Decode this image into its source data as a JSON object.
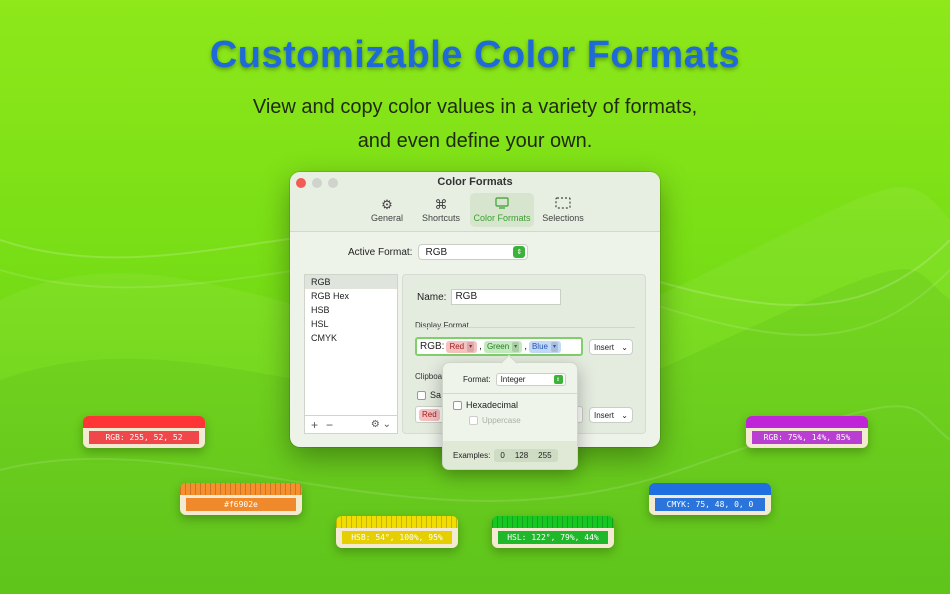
{
  "headline": "Customizable Color Formats",
  "subtitle": {
    "line1": "View and copy color values in a variety of formats,",
    "line2": "and even define your own."
  },
  "window": {
    "title": "Color Formats",
    "toolbar": [
      {
        "label": "General",
        "icon": "gear-icon"
      },
      {
        "label": "Shortcuts",
        "icon": "command-icon"
      },
      {
        "label": "Color Formats",
        "icon": "display-icon",
        "active": true
      },
      {
        "label": "Selections",
        "icon": "selection-icon"
      }
    ],
    "active_format_label": "Active Format:",
    "active_format_value": "RGB",
    "formats": [
      "RGB",
      "RGB Hex",
      "HSB",
      "HSL",
      "CMYK"
    ],
    "selected_format": "RGB",
    "list_footer": {
      "add": "+",
      "remove": "−",
      "gear": "⚙ ⌄"
    },
    "name_label": "Name:",
    "name_value": "RGB",
    "display_format_label": "Display Format",
    "display_prefix": "RGB:",
    "tokens": [
      "Red",
      "Green",
      "Blue"
    ],
    "separator": ",",
    "insert_label": "Insert",
    "clipboard_label": "Clipboa",
    "clipboard_checkbox": "Sa",
    "clipboard_token": "Red"
  },
  "popover": {
    "format_label": "Format:",
    "format_value": "Integer",
    "hexadecimal": "Hexadecimal",
    "uppercase": "Uppercase",
    "examples_label": "Examples:",
    "examples": [
      "0",
      "128",
      "255"
    ]
  },
  "swatches": [
    {
      "label": "RGB: 255, 52, 52",
      "color": "#ff3434",
      "label_bg": "#f0474a"
    },
    {
      "label": "#f6902e",
      "color": "#f6902e",
      "label_bg": "#f0892b"
    },
    {
      "label": "HSB: 54°, 100%, 95%",
      "color": "#f2dd00",
      "label_bg": "#e5cf00"
    },
    {
      "label": "HSL: 122°, 79%, 44%",
      "color": "#17c722",
      "label_bg": "#1fb82a"
    },
    {
      "label": "CMYK: 75, 48, 0, 0",
      "color": "#1f6fe0",
      "label_bg": "#2a74db"
    },
    {
      "label": "RGB: 75%, 14%, 85%",
      "color": "#bf24d9",
      "label_bg": "#b93fd2"
    }
  ],
  "colors": {
    "headline": "#1e6ad8",
    "accent_green": "#3bb339",
    "background": "#7adf16"
  }
}
